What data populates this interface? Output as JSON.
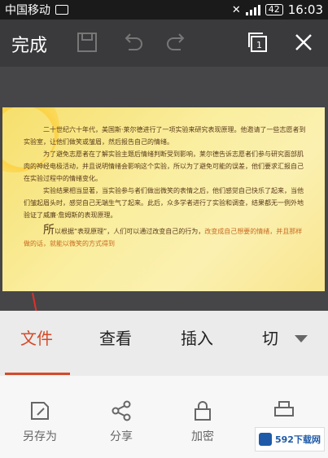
{
  "status": {
    "carrier": "中国移动",
    "battery": "42",
    "time": "16:03"
  },
  "toolbar": {
    "done_label": "完成"
  },
  "document": {
    "paragraphs": [
      {
        "lead": "",
        "text": "二十世纪六十年代，美国斯·莱尔德进行了一项实验来研究表现原理。他邀请了一些志愿者到实验室，让他们做笑或皱眉，然后报告自己的情绪。"
      },
      {
        "lead": "",
        "text": "为了避免志愿者在了解实验主题后情绪判断受到影响，莱尔德告诉志愿者们参与研究面部肌肉的神经电极活动，并且说明情绪会影响这个实验，所以为了避免可能的误差，他们要求汇报自己在实验过程中的情绪变化。"
      },
      {
        "lead": "",
        "text": "实验结果相当显著，当实验参与者们做出微笑的表情之后，他们感觉自己快乐了起来，当他们皱起眉头时，感觉自己无端生气了起来。此后，众多学者进行了实验和调查，结果都无一例外地验证了威廉·詹姆斯的表现原理。"
      },
      {
        "lead": "所",
        "text": "以根据“表现原理”，人们可以通过改变自己的行为，",
        "highlight": "改变成自己想要的情绪，并且那样做的话，就能以微笑的方式得到"
      }
    ]
  },
  "tabs": [
    {
      "label": "文件",
      "active": true
    },
    {
      "label": "查看"
    },
    {
      "label": "插入"
    },
    {
      "label": "切"
    }
  ],
  "actions": [
    {
      "label": "另存为",
      "icon": "save-as-icon"
    },
    {
      "label": "分享",
      "icon": "share-icon"
    },
    {
      "label": "加密",
      "icon": "lock-icon"
    },
    {
      "label": "",
      "icon": "print-icon"
    }
  ],
  "watermark": {
    "text": "592下载网"
  },
  "colors": {
    "accent": "#d44a2a",
    "toolbar_bg": "#3a3a3c",
    "doc_bg": "#f8e58e"
  }
}
